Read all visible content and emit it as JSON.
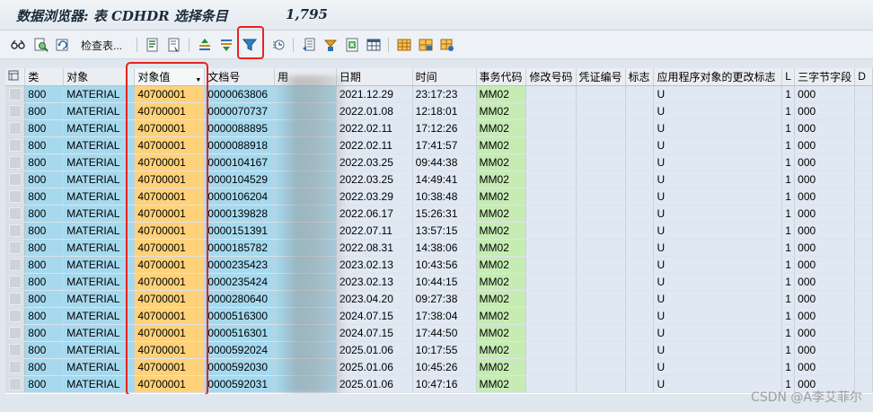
{
  "title": {
    "text": "数据浏览器: 表 CDHDR 选择条目",
    "count": "1,795"
  },
  "toolbar": {
    "check_table_label": "检查表..."
  },
  "columns": [
    "类",
    "对象",
    "对象值",
    "文档号",
    "用",
    "日期",
    "时间",
    "事务代码",
    "修改号码",
    "凭证编号",
    "标志",
    "应用程序对象的更改标志",
    "L",
    "三字节字段",
    "D"
  ],
  "rows": [
    {
      "cls": "800",
      "obj": "MATERIAL",
      "objval": "40700001",
      "doc": "0000063806",
      "date": "2021.12.29",
      "time": "23:17:23",
      "tcode": "MM02",
      "change": "U",
      "l": "1",
      "tri": "000"
    },
    {
      "cls": "800",
      "obj": "MATERIAL",
      "objval": "40700001",
      "doc": "0000070737",
      "date": "2022.01.08",
      "time": "12:18:01",
      "tcode": "MM02",
      "change": "U",
      "l": "1",
      "tri": "000"
    },
    {
      "cls": "800",
      "obj": "MATERIAL",
      "objval": "40700001",
      "doc": "0000088895",
      "date": "2022.02.11",
      "time": "17:12:26",
      "tcode": "MM02",
      "change": "U",
      "l": "1",
      "tri": "000"
    },
    {
      "cls": "800",
      "obj": "MATERIAL",
      "objval": "40700001",
      "doc": "0000088918",
      "date": "2022.02.11",
      "time": "17:41:57",
      "tcode": "MM02",
      "change": "U",
      "l": "1",
      "tri": "000"
    },
    {
      "cls": "800",
      "obj": "MATERIAL",
      "objval": "40700001",
      "doc": "0000104167",
      "date": "2022.03.25",
      "time": "09:44:38",
      "tcode": "MM02",
      "change": "U",
      "l": "1",
      "tri": "000"
    },
    {
      "cls": "800",
      "obj": "MATERIAL",
      "objval": "40700001",
      "doc": "0000104529",
      "date": "2022.03.25",
      "time": "14:49:41",
      "tcode": "MM02",
      "change": "U",
      "l": "1",
      "tri": "000"
    },
    {
      "cls": "800",
      "obj": "MATERIAL",
      "objval": "40700001",
      "doc": "0000106204",
      "date": "2022.03.29",
      "time": "10:38:48",
      "tcode": "MM02",
      "change": "U",
      "l": "1",
      "tri": "000"
    },
    {
      "cls": "800",
      "obj": "MATERIAL",
      "objval": "40700001",
      "doc": "0000139828",
      "date": "2022.06.17",
      "time": "15:26:31",
      "tcode": "MM02",
      "change": "U",
      "l": "1",
      "tri": "000"
    },
    {
      "cls": "800",
      "obj": "MATERIAL",
      "objval": "40700001",
      "doc": "0000151391",
      "date": "2022.07.11",
      "time": "13:57:15",
      "tcode": "MM02",
      "change": "U",
      "l": "1",
      "tri": "000"
    },
    {
      "cls": "800",
      "obj": "MATERIAL",
      "objval": "40700001",
      "doc": "0000185782",
      "date": "2022.08.31",
      "time": "14:38:06",
      "tcode": "MM02",
      "change": "U",
      "l": "1",
      "tri": "000"
    },
    {
      "cls": "800",
      "obj": "MATERIAL",
      "objval": "40700001",
      "doc": "0000235423",
      "date": "2023.02.13",
      "time": "10:43:56",
      "tcode": "MM02",
      "change": "U",
      "l": "1",
      "tri": "000"
    },
    {
      "cls": "800",
      "obj": "MATERIAL",
      "objval": "40700001",
      "doc": "0000235424",
      "date": "2023.02.13",
      "time": "10:44:15",
      "tcode": "MM02",
      "change": "U",
      "l": "1",
      "tri": "000"
    },
    {
      "cls": "800",
      "obj": "MATERIAL",
      "objval": "40700001",
      "doc": "0000280640",
      "date": "2023.04.20",
      "time": "09:27:38",
      "tcode": "MM02",
      "change": "U",
      "l": "1",
      "tri": "000"
    },
    {
      "cls": "800",
      "obj": "MATERIAL",
      "objval": "40700001",
      "doc": "0000516300",
      "date": "2024.07.15",
      "time": "17:38:04",
      "tcode": "MM02",
      "change": "U",
      "l": "1",
      "tri": "000"
    },
    {
      "cls": "800",
      "obj": "MATERIAL",
      "objval": "40700001",
      "doc": "0000516301",
      "date": "2024.07.15",
      "time": "17:44:50",
      "tcode": "MM02",
      "change": "U",
      "l": "1",
      "tri": "000"
    },
    {
      "cls": "800",
      "obj": "MATERIAL",
      "objval": "40700001",
      "doc": "0000592024",
      "date": "2025.01.06",
      "time": "10:17:55",
      "tcode": "MM02",
      "change": "U",
      "l": "1",
      "tri": "000"
    },
    {
      "cls": "800",
      "obj": "MATERIAL",
      "objval": "40700001",
      "doc": "0000592030",
      "date": "2025.01.06",
      "time": "10:45:26",
      "tcode": "MM02",
      "change": "U",
      "l": "1",
      "tri": "000"
    },
    {
      "cls": "800",
      "obj": "MATERIAL",
      "objval": "40700001",
      "doc": "0000592031",
      "date": "2025.01.06",
      "time": "10:47:16",
      "tcode": "MM02",
      "change": "U",
      "l": "1",
      "tri": "000"
    }
  ],
  "watermark": "CSDN @A李艾菲尔",
  "icons": [
    "glasses-icon",
    "search-doc-icon",
    "refresh-icon",
    "details-icon",
    "select-doc-icon",
    "sort-ascending-icon",
    "sort-descending-icon",
    "filter-icon",
    "sum-icon",
    "export-icon",
    "print-icon",
    "spreadsheet-icon",
    "grid-layout-icon",
    "layout-settings-icon"
  ],
  "colors": {
    "key_cell": "#a6d9ee",
    "object_value_cell": "#ffd27a",
    "tcode_cell": "#c6ecb4",
    "highlight": "#e8221f"
  }
}
